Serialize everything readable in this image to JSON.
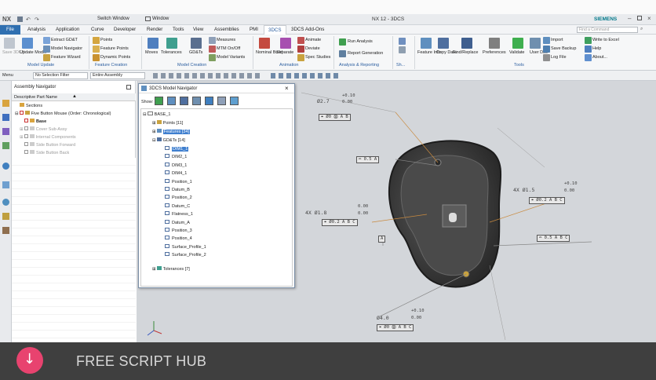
{
  "app": {
    "logo": "NX",
    "window_title": "NX 12 - 3DCS",
    "brand": "SIEMENS",
    "switch_window": "Switch Window",
    "window_menu": "Window",
    "search_placeholder": "Find a Command"
  },
  "menubar": {
    "file": "File",
    "tabs": [
      "Analysis",
      "Application",
      "Curve",
      "Developer",
      "Render",
      "Tools",
      "View",
      "Assemblies",
      "PMI",
      "3DCS",
      "3DCS Add-Ons"
    ],
    "active": "3DCS"
  },
  "ribbon": {
    "save": "Save 3DCS",
    "update_model": "Update Model",
    "model_update_items": [
      "Extract GD&T",
      "Model Navigator",
      "Feature Wizard"
    ],
    "feature_creation_items": [
      "Points",
      "Feature Points",
      "Dynamic Points"
    ],
    "moves": "Moves",
    "tolerances": "Tolerances",
    "gdts": "GD&Ts",
    "model_creation_items": [
      "Measures",
      "MTM On/Off",
      "Model Variants"
    ],
    "nominal_build": "Nominal Build",
    "separate": "Separate",
    "animation_items": [
      "Animate",
      "Deviate",
      "Spec Studies"
    ],
    "analysis_items": [
      "Run Analysis",
      "Report Generation"
    ],
    "feature_info": "Feature Info",
    "copy_data": "Copy Data",
    "find_replace": "Find/Replace",
    "preferences": "Preferences",
    "validate": "Validate",
    "user_dll": "User DLL",
    "tools_items": [
      "Import",
      "Save Backup",
      "Log File"
    ],
    "misc_items": [
      "Write to Excel",
      "Help",
      "About..."
    ],
    "groups": [
      "Model Update",
      "Feature Creation",
      "Model Creation",
      "Animation",
      "Analysis & Reporting",
      "Sh...",
      "Tools"
    ]
  },
  "toolbar2": {
    "menu": "Menu",
    "selection_filter": "No Selection Filter",
    "assembly_scope": "Entire Assembly"
  },
  "assembly_navigator": {
    "title": "Assembly Navigator",
    "column": "Descriptive Part Name",
    "rows": [
      {
        "label": "Sections",
        "grey": false
      },
      {
        "label": "Five Button Mouse (Order: Chronological)",
        "grey": false
      },
      {
        "label": "Base",
        "grey": false
      },
      {
        "label": "Cover Sub-Assy",
        "grey": true
      },
      {
        "label": "Internal Components",
        "grey": true
      },
      {
        "label": "Side Button Forward",
        "grey": true
      },
      {
        "label": "Side Button Back",
        "grey": true
      }
    ]
  },
  "model_navigator": {
    "title": "3DCS Model Navigator",
    "show_label": "Show:",
    "root": "BASE_1",
    "points": "Points [11]",
    "features": "Features [34]",
    "gdts": "GD&Ts [14]",
    "gdt_items": [
      "DIM1_1",
      "DIM2_1",
      "DIM3_1",
      "DIM4_1",
      "Position_1",
      "Datum_B",
      "Position_2",
      "Datum_C",
      "Flatness_1",
      "Datum_A",
      "Position_3",
      "Position_4",
      "Surface_Profile_1",
      "Surface_Profile_2"
    ],
    "selected": "DIM1_1",
    "tolerances": "Tolerances [7]"
  },
  "annotations": {
    "dim_top": "Ø2.7",
    "dim_top_tol": "+0.10",
    "dim_top_tol2": "0.00",
    "fcf_top": "⌖ Ø0 Ⓜ A B",
    "fcf_surface": "⌓ 0.5 A",
    "dim_right": "4X Ø1.5",
    "dim_right_tol": "+0.10",
    "dim_right_tol2": "0.00",
    "fcf_right": "⌖ Ø0.2 A B C",
    "fcf_right2": "⌓ 0.5 A B C",
    "dim_left": "4X Ø1.8",
    "dim_left_tol": "0.00",
    "dim_left_tol2": "0.00",
    "fcf_left": "⌖ Ø0.2 A B C",
    "datum_a": "A",
    "dim_bottom": "Ø4.0",
    "dim_bottom_tol": "+0.10",
    "dim_bottom_tol2": "0.00",
    "fcf_bottom": "⌖ Ø0 Ⓜ A B C"
  },
  "banner": {
    "text": "FREE SCRIPT HUB",
    "accent": "#e8436f"
  }
}
